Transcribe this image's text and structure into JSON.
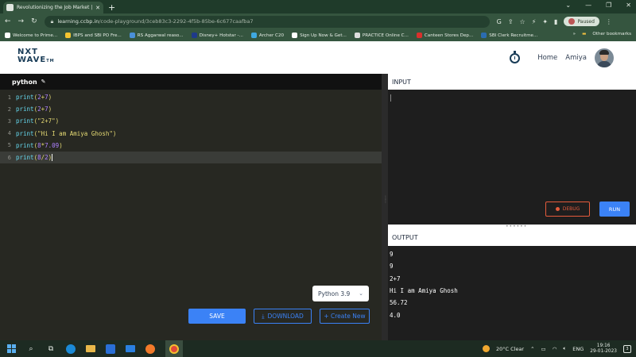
{
  "browser": {
    "tab_title": "Revolutionizing the Job Market |",
    "url_host": "learning.ccbp.in",
    "url_path": "/code-playground/3ceb83c3-2292-4f5b-85be-6c677caafba7",
    "profile_status": "Paused",
    "bookmarks": [
      {
        "label": "Welcome to Prime...",
        "color": "#ffffff"
      },
      {
        "label": "IBPS and SBI PO Fre...",
        "color": "#f4c430"
      },
      {
        "label": "RS Aggarwal reaso...",
        "color": "#4a90d9"
      },
      {
        "label": "Disney+ Hotstar -...",
        "color": "#1f3a8a"
      },
      {
        "label": "Archer C20",
        "color": "#3fa8e0"
      },
      {
        "label": "Sign Up Now & Get...",
        "color": "#ffffff"
      },
      {
        "label": "PRACTICE Online C...",
        "color": "#dddddd"
      },
      {
        "label": "Canteen Stores Dep...",
        "color": "#d9302c"
      },
      {
        "label": "SBI Clerk Recruitme...",
        "color": "#2b6cb0"
      }
    ],
    "other_bookmarks": "Other bookmarks"
  },
  "header": {
    "logo_line1": "NXT",
    "logo_line2": "WAVE",
    "logo_tm": "TM",
    "home_label": "Home",
    "user_name": "Amiya"
  },
  "editor": {
    "language": "python",
    "lines": [
      {
        "n": "1",
        "code": "print(2+7)"
      },
      {
        "n": "2",
        "code": "print(2+7)"
      },
      {
        "n": "3",
        "code": "print(\"2+7\")"
      },
      {
        "n": "4",
        "code": "print(\"Hi I am Amiya Ghosh\")"
      },
      {
        "n": "5",
        "code": "print(8*7.09)"
      },
      {
        "n": "6",
        "code": "print(8/2)"
      }
    ],
    "version_select": "Python 3.9",
    "save_label": "SAVE",
    "download_label": "DOWNLOAD",
    "create_label": "+ Create New"
  },
  "input_panel": {
    "title": "INPUT",
    "debug_label": "DEBUG",
    "run_label": "RUN"
  },
  "output_panel": {
    "title": "OUTPUT",
    "lines": [
      "9",
      "9",
      "2+7",
      "Hi I am Amiya Ghosh",
      "56.72",
      "4.0"
    ]
  },
  "taskbar": {
    "weather": "20°C  Clear",
    "lang": "ENG",
    "time": "19:16",
    "date": "29-01-2023",
    "notifications": "3"
  }
}
